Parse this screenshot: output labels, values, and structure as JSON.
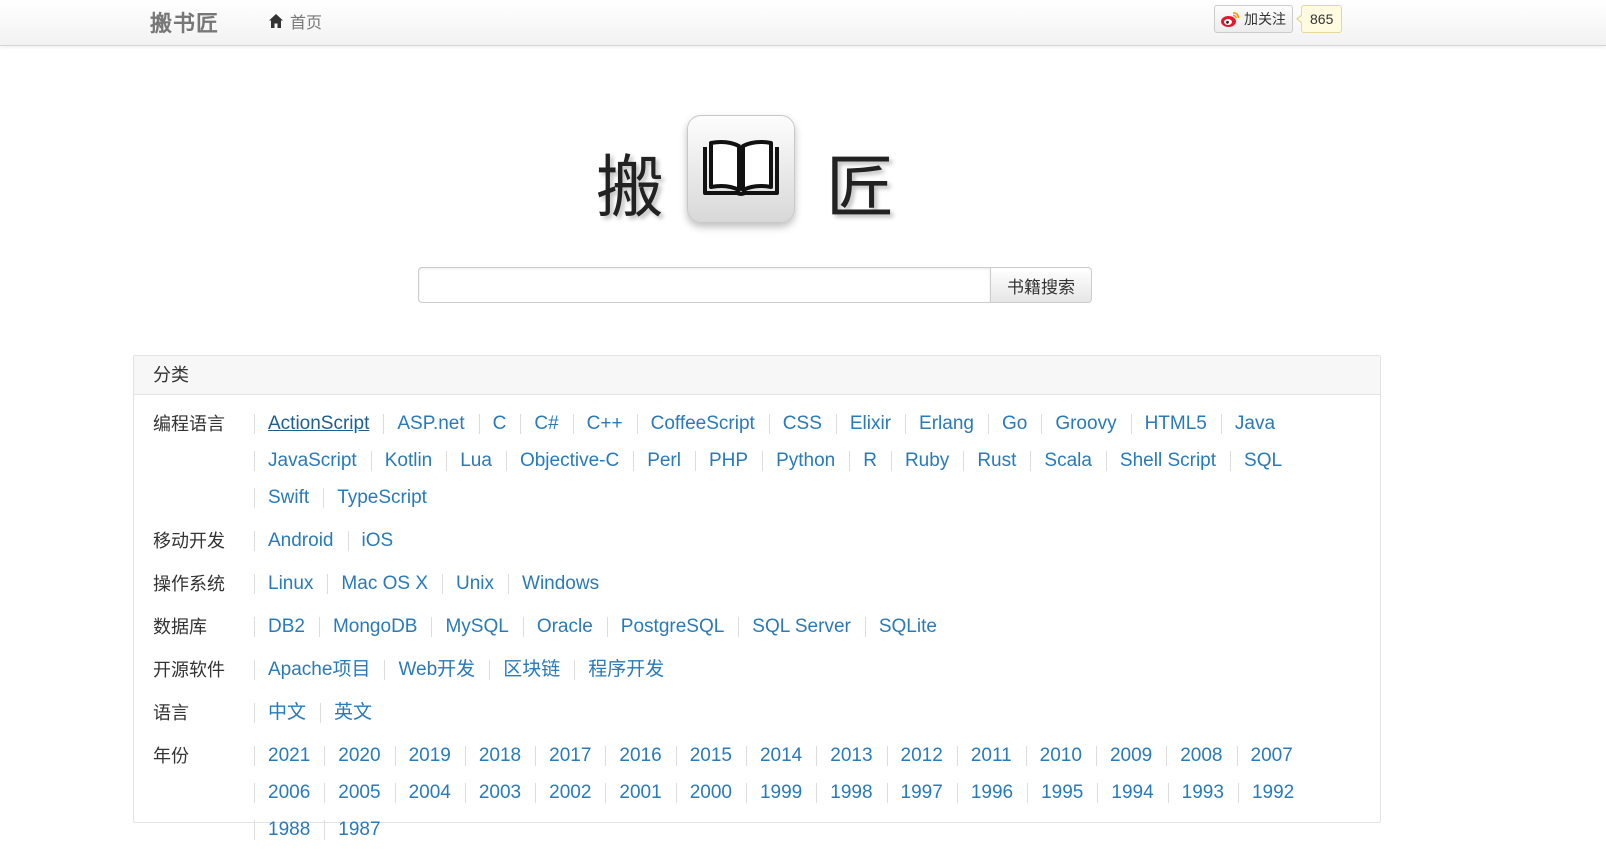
{
  "navbar": {
    "brand": "搬书匠",
    "home_label": "首页",
    "weibo_follow_label": "加关注",
    "weibo_count": "865"
  },
  "logo": {
    "char_left": "搬",
    "char_right": "匠",
    "icon": "open-book-icon"
  },
  "search": {
    "placeholder": "",
    "value": "",
    "button_label": "书籍搜索"
  },
  "categories": {
    "title": "分类",
    "rows": [
      {
        "label": "编程语言",
        "items": [
          "ActionScript",
          "ASP.net",
          "C",
          "C#",
          "C++",
          "CoffeeScript",
          "CSS",
          "Elixir",
          "Erlang",
          "Go",
          "Groovy",
          "HTML5",
          "Java",
          "JavaScript",
          "Kotlin",
          "Lua",
          "Objective-C",
          "Perl",
          "PHP",
          "Python",
          "R",
          "Ruby",
          "Rust",
          "Scala",
          "Shell Script",
          "SQL",
          "Swift",
          "TypeScript"
        ]
      },
      {
        "label": "移动开发",
        "items": [
          "Android",
          "iOS"
        ]
      },
      {
        "label": "操作系统",
        "items": [
          "Linux",
          "Mac OS X",
          "Unix",
          "Windows"
        ]
      },
      {
        "label": "数据库",
        "items": [
          "DB2",
          "MongoDB",
          "MySQL",
          "Oracle",
          "PostgreSQL",
          "SQL Server",
          "SQLite"
        ]
      },
      {
        "label": "开源软件",
        "items": [
          "Apache项目",
          "Web开发",
          "区块链",
          "程序开发"
        ]
      },
      {
        "label": "语言",
        "items": [
          "中文",
          "英文"
        ]
      },
      {
        "label": "年份",
        "items": [
          "2021",
          "2020",
          "2019",
          "2018",
          "2017",
          "2016",
          "2015",
          "2014",
          "2013",
          "2012",
          "2011",
          "2010",
          "2009",
          "2008",
          "2007",
          "2006",
          "2005",
          "2004",
          "2003",
          "2002",
          "2001",
          "2000",
          "1999",
          "1998",
          "1997",
          "1996",
          "1995",
          "1994",
          "1993",
          "1992",
          "1988",
          "1987"
        ]
      }
    ],
    "active_item": "ActionScript"
  },
  "colors": {
    "link": "#2a7ab8",
    "navbar_text": "#777777",
    "weibo_red": "#e6162d"
  }
}
